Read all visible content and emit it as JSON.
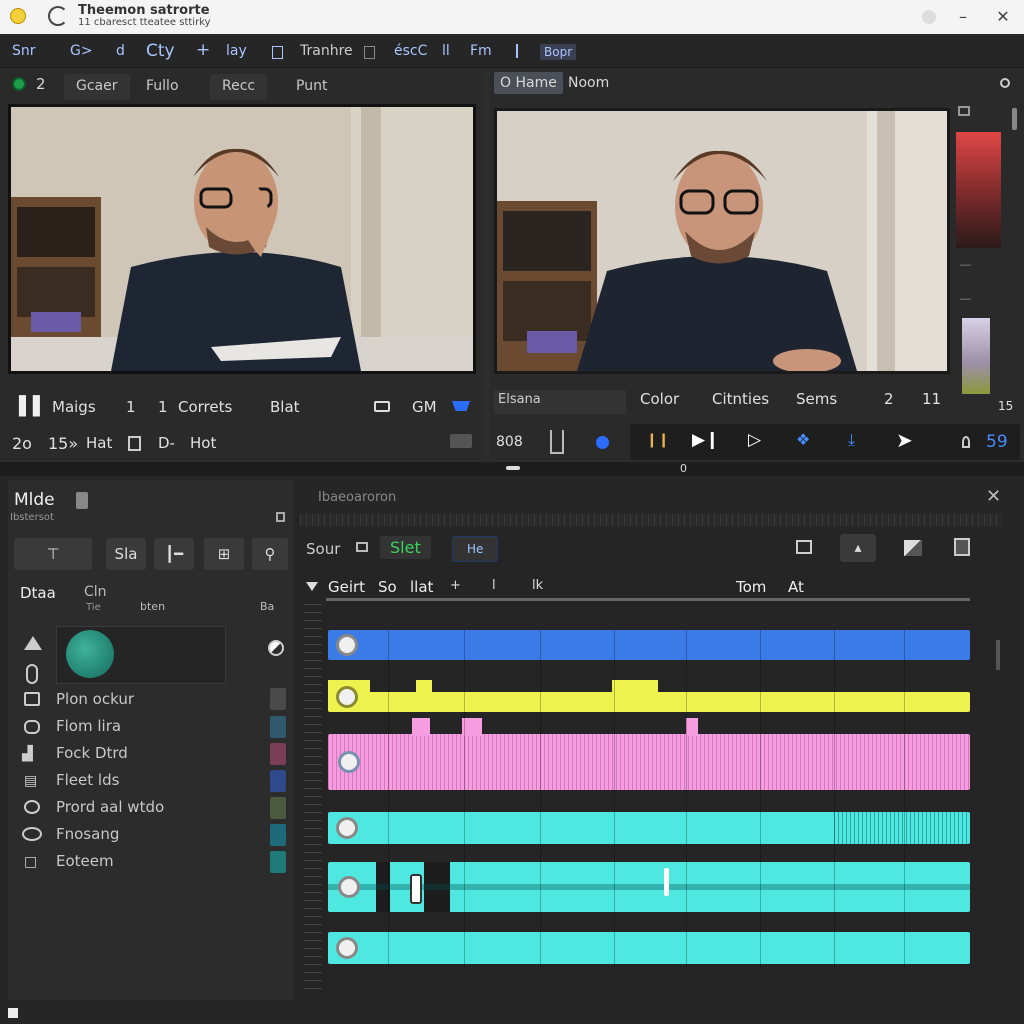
{
  "titlebar": {
    "title": "Theemon satrorte",
    "subtitle": "11 cbaresct   tteatee sttirky"
  },
  "menu": {
    "items": [
      "Snr",
      "G>",
      "d",
      "Cty",
      "+",
      "lay",
      "Tranhre",
      "éscC",
      "ll",
      "Fm",
      "Bopr"
    ]
  },
  "left": {
    "badge_count": "2",
    "tabs": [
      "Gcaer",
      "Fullo",
      "Recc",
      "Punt"
    ],
    "row1": {
      "pause": "▐▐",
      "label1": "Maigs",
      "n1": "1",
      "n2": "1",
      "label2": "Correts",
      "label3": "Blat",
      "label4": "GM"
    },
    "row2": {
      "a": "2o",
      "b": "15»",
      "c": "Hat",
      "d": "D-",
      "e": "Hot"
    }
  },
  "right": {
    "tabs": [
      "O Hame",
      "Noom"
    ],
    "row1": {
      "a": "Elsana",
      "b": "Color",
      "c": "Citnties",
      "d": "Sems",
      "e": "2",
      "f": "11",
      "g": "15"
    },
    "row2": {
      "a": "808",
      "b": "59"
    }
  },
  "divider_value": "0",
  "bottom": {
    "title": "Mlde",
    "subtitle": "Ibstersot",
    "header_label": "Ibaeoaroron",
    "tools": {
      "sla": "Sla"
    },
    "cols": {
      "a": "Dtaa",
      "b": "Cln",
      "b2": "Tie",
      "c": "bten",
      "d": "Ba"
    },
    "items": [
      "Plon ockur",
      "Flom lira",
      "Fock Dtrd",
      "Fleet lds",
      "Prord aal wtdo",
      "Fnosang",
      "Eoteem"
    ],
    "swatch_colors": [
      "#4a4a4a",
      "#2f5a6e",
      "#7a3d56",
      "#2e4a8a",
      "#4a5a3e",
      "#1e6a7a",
      "#1f7a7a"
    ]
  },
  "timeline": {
    "toolbar": {
      "a": "Sour",
      "b": "Slet",
      "c": "He"
    },
    "header": [
      "Geirt",
      "So",
      "llat",
      "+",
      "l",
      "lk",
      "Tom",
      "At"
    ],
    "track_colors": [
      "#3b7be8",
      "#eef24e",
      "#f59de0",
      "#4fe8e0",
      "#4fe8e0",
      "#4fe8e0"
    ]
  }
}
